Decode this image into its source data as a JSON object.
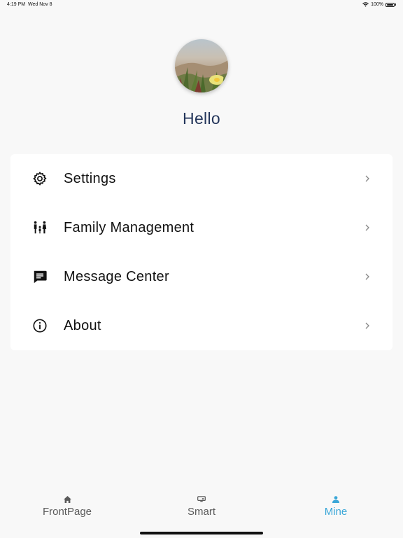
{
  "status_bar": {
    "time": "4:19 PM",
    "date": "Wed Nov 8",
    "battery": "100%"
  },
  "profile": {
    "greeting": "Hello"
  },
  "menu": {
    "items": [
      {
        "label": "Settings",
        "icon": "gear-icon"
      },
      {
        "label": "Family Management",
        "icon": "family-icon"
      },
      {
        "label": "Message Center",
        "icon": "message-icon"
      },
      {
        "label": "About",
        "icon": "info-icon"
      }
    ]
  },
  "tabs": [
    {
      "label": "FrontPage",
      "icon": "home-icon",
      "active": false
    },
    {
      "label": "Smart",
      "icon": "device-icon",
      "active": false
    },
    {
      "label": "Mine",
      "icon": "person-icon",
      "active": true
    }
  ],
  "colors": {
    "greeting": "#23355a",
    "tab_active": "#3ba7d8",
    "tab_inactive": "#5a5a5a",
    "background": "#f8f8f8"
  }
}
